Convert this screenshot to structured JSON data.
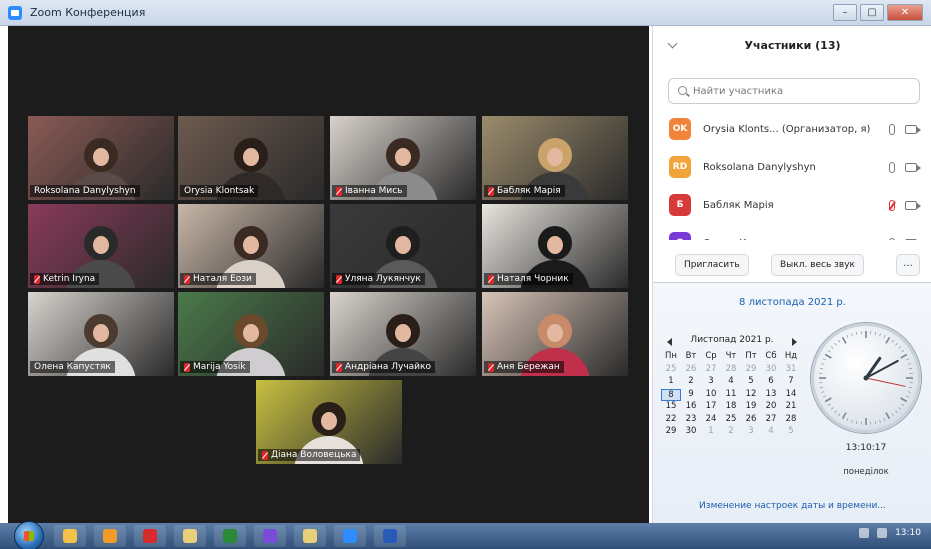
{
  "window": {
    "title": "Zoom Конференция",
    "controls": [
      "–",
      "▢",
      "✕"
    ]
  },
  "videos": [
    {
      "name": "Roksolana Danylyshyn",
      "muted": false,
      "active": false,
      "bg": "#8a5a55",
      "hair": "#3b2a22",
      "shirt": "#5a4a48"
    },
    {
      "name": "Orysia Klontsak",
      "muted": false,
      "active": true,
      "bg": "#6d5a4f",
      "hair": "#2a1e18",
      "shirt": "#2f2a28"
    },
    {
      "name": "Іванна Мись",
      "muted": true,
      "active": false,
      "bg": "#d8d2cc",
      "hair": "#3a2a22",
      "shirt": "#8c8c8c"
    },
    {
      "name": "Бабляк Марія",
      "muted": true,
      "active": false,
      "bg": "#9c8c6c",
      "hair": "#c9a36a",
      "shirt": "#3a3a3a"
    },
    {
      "name": "Ketrin Iryna",
      "muted": true,
      "active": false,
      "bg": "#8a3a5a",
      "hair": "#2a2a2a",
      "shirt": "#4a4a4a"
    },
    {
      "name": "Наталя Еози",
      "muted": true,
      "active": false,
      "bg": "#c9b7a8",
      "hair": "#3b2a22",
      "shirt": "#d9d0c8"
    },
    {
      "name": "Уляна Лукянчук",
      "muted": true,
      "active": false,
      "bg": "#3a3a3a",
      "hair": "#1f1f1f",
      "shirt": "#5a5a5a"
    },
    {
      "name": "Наталя Чорник",
      "muted": true,
      "active": false,
      "bg": "#e8e4de",
      "hair": "#1a1a1a",
      "shirt": "#1a1a1a"
    },
    {
      "name": "Олена Капустяк",
      "muted": false,
      "active": false,
      "bg": "#d8d4cf",
      "hair": "#4a3a30",
      "shirt": "#e0e0e0"
    },
    {
      "name": "Marija Yosik",
      "muted": true,
      "active": false,
      "bg": "#4a7a4a",
      "hair": "#6a4a2a",
      "shirt": "#d0cdd0"
    },
    {
      "name": "Андріана Лучайко",
      "muted": true,
      "active": false,
      "bg": "#d9d4ce",
      "hair": "#2a1e18",
      "shirt": "#444444"
    },
    {
      "name": "Аня Бережан",
      "muted": true,
      "active": false,
      "bg": "#d8c4b8",
      "hair": "#c98a6a",
      "shirt": "#c0304a"
    },
    {
      "name": "Діана Воловецька",
      "muted": true,
      "active": false,
      "bg": "#c8c040",
      "hair": "#2a1e18",
      "shirt": "#e6e0dc"
    }
  ],
  "participants": {
    "title": "Участники (13)",
    "search_placeholder": "Найти участника",
    "items": [
      {
        "initials": "OK",
        "name": "Orysia Klonts... (Организатор, я)",
        "color": "#f2833a",
        "mic_muted": false
      },
      {
        "initials": "RD",
        "name": "Roksolana Danylyshyn",
        "color": "#f2a33a",
        "mic_muted": false
      },
      {
        "initials": "Б",
        "name": "Бабляк Марія",
        "color": "#d83a3a",
        "mic_muted": true
      },
      {
        "initials": "О",
        "name": "Олена Капустяк",
        "color": "#7a3ad8",
        "mic_muted": false
      }
    ],
    "invite_label": "Пригласить",
    "mute_all_label": "Выкл. весь звук",
    "more_label": "..."
  },
  "calendar": {
    "date_link": "8 листопада 2021 р.",
    "month_label": "Листопад 2021 р.",
    "weekdays": [
      "Пн",
      "Вт",
      "Ср",
      "Чт",
      "Пт",
      "Сб",
      "Нд"
    ],
    "days": [
      [
        "25",
        "26",
        "27",
        "28",
        "29",
        "30",
        "31"
      ],
      [
        "1",
        "2",
        "3",
        "4",
        "5",
        "6",
        "7"
      ],
      [
        "8",
        "9",
        "10",
        "11",
        "12",
        "13",
        "14"
      ],
      [
        "15",
        "16",
        "17",
        "18",
        "19",
        "20",
        "21"
      ],
      [
        "22",
        "23",
        "24",
        "25",
        "26",
        "27",
        "28"
      ],
      [
        "29",
        "30",
        "1",
        "2",
        "3",
        "4",
        "5"
      ]
    ],
    "today": "8",
    "clock_time": "13:10:17",
    "clock_hours": 13,
    "clock_minutes": 10,
    "clock_seconds": 17,
    "day_name": "понеділок",
    "settings_link": "Изменение настроек даты и времени..."
  },
  "taskbar": {
    "apps": [
      {
        "name": "explorer-app",
        "color": "#f2c24a"
      },
      {
        "name": "media-player-app",
        "color": "#f29a2a"
      },
      {
        "name": "opera-app",
        "color": "#d82a2a"
      },
      {
        "name": "folder-app",
        "color": "#e8d07a"
      },
      {
        "name": "excel-app",
        "color": "#2a8a3a"
      },
      {
        "name": "viber-app",
        "color": "#7a4ad8"
      },
      {
        "name": "app-folder",
        "color": "#e8d07a"
      },
      {
        "name": "zoom-app",
        "color": "#2d8cff"
      },
      {
        "name": "word-app",
        "color": "#2a5ab8"
      }
    ],
    "clock": "13:10"
  }
}
